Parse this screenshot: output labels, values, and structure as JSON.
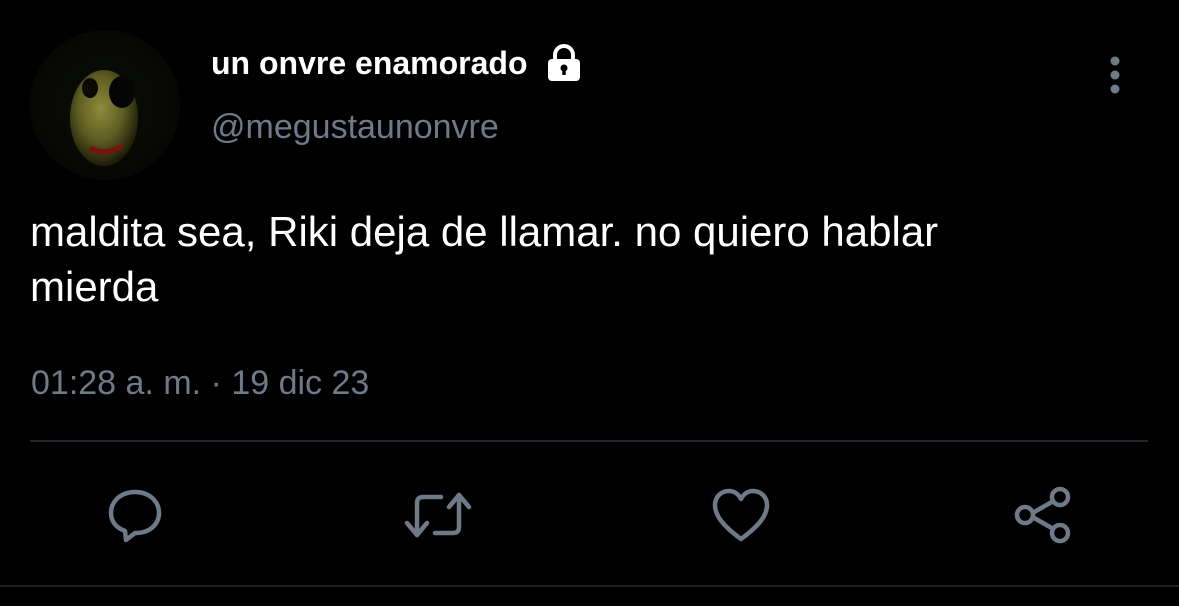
{
  "user": {
    "display_name": "un onvre enamorado",
    "handle": "@megustaunonvre",
    "protected": true
  },
  "tweet": {
    "text": "maldita sea, Riki deja de llamar. no quiero hablar\nmierda",
    "timestamp": "01:28 a. m. · 19 dic 23"
  },
  "actions": [
    {
      "name": "reply",
      "icon": "speech-bubble-icon"
    },
    {
      "name": "retweet",
      "icon": "retweet-icon"
    },
    {
      "name": "like",
      "icon": "heart-icon"
    },
    {
      "name": "share",
      "icon": "share-icon"
    }
  ],
  "colors": {
    "background": "#000000",
    "text": "#ffffff",
    "muted": "#6e7a88",
    "divider": "#22272d"
  }
}
